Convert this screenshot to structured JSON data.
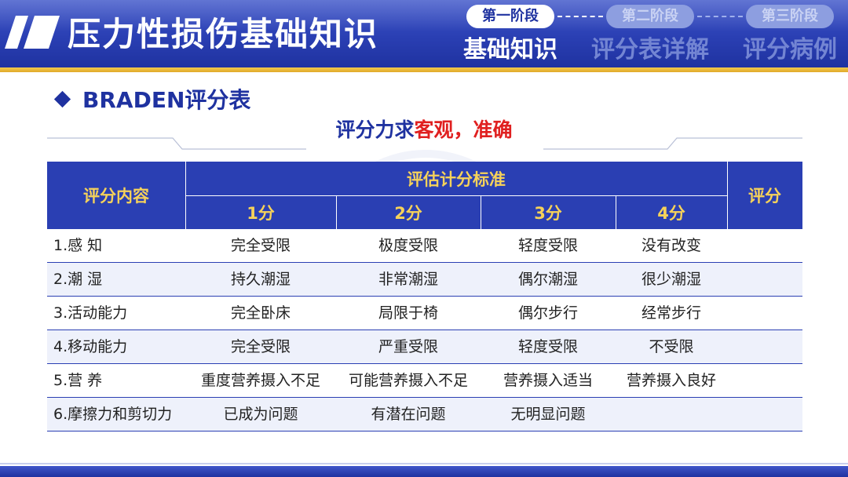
{
  "header": {
    "title": "压力性损伤基础知识",
    "stages": [
      {
        "pill": "第一阶段",
        "label": "基础知识",
        "active": true
      },
      {
        "pill": "第二阶段",
        "label": "评分表详解",
        "active": false
      },
      {
        "pill": "第三阶段",
        "label": "评分病例",
        "active": false
      }
    ]
  },
  "section": {
    "icon": "diamond-icon",
    "heading": "BRADEN评分表"
  },
  "subtitle": {
    "part1": "评分力求",
    "part2": "客观，准确"
  },
  "colors": {
    "primary": "#2a3fb3",
    "header_text": "#f6d25a",
    "accent_red": "#e02020",
    "gold": "#e0a92a"
  },
  "table": {
    "header": {
      "content": "评分内容",
      "criteria": "评估计分标准",
      "score": "评分",
      "levels": [
        "1分",
        "2分",
        "3分",
        "4分"
      ]
    },
    "rows": [
      {
        "item": "1.感  知",
        "s1": "完全受限",
        "s2": "极度受限",
        "s3": "轻度受限",
        "s4": "没有改变",
        "score": ""
      },
      {
        "item": "2.潮  湿",
        "s1": "持久潮湿",
        "s2": "非常潮湿",
        "s3": "偶尔潮湿",
        "s4": "很少潮湿",
        "score": ""
      },
      {
        "item": "3.活动能力",
        "s1": "完全卧床",
        "s2": "局限于椅",
        "s3": "偶尔步行",
        "s4": "经常步行",
        "score": ""
      },
      {
        "item": "4.移动能力",
        "s1": "完全受限",
        "s2": "严重受限",
        "s3": "轻度受限",
        "s4": "不受限",
        "score": ""
      },
      {
        "item": "5.营  养",
        "s1": "重度营养摄入不足",
        "s2": "可能营养摄入不足",
        "s3": "营养摄入适当",
        "s4": "营养摄入良好",
        "score": ""
      },
      {
        "item": "6.摩擦力和剪切力",
        "s1": "已成为问题",
        "s2": "有潜在问题",
        "s3": "无明显问题",
        "s4": "",
        "score": ""
      }
    ]
  }
}
